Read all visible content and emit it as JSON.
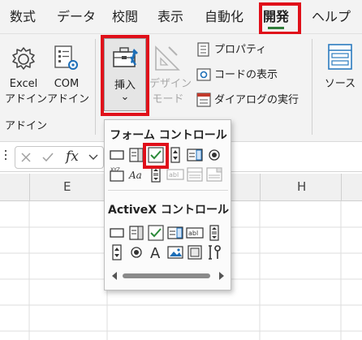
{
  "tabs": [
    "数式",
    "データ",
    "校閲",
    "表示",
    "自動化",
    "開発",
    "ヘルプ"
  ],
  "ribbon": {
    "excel_addin": [
      "Excel",
      "アドイン"
    ],
    "com_addin": [
      "COM",
      "アドイン"
    ],
    "group_addin": "アドイン",
    "insert": "挿入",
    "insert_arrow": "⌄",
    "design_mode": [
      "デザイン",
      "モード"
    ],
    "properties": "プロパティ",
    "view_code": "コードの表示",
    "run_dialog": "ダイアログの実行",
    "source": "ソース"
  },
  "formula_bar": {
    "fx": "fx"
  },
  "columns": [
    "E",
    "H"
  ],
  "dropdown": {
    "form_controls_title": "フォーム コントロール",
    "activex_title": "ActiveX コントロール",
    "xyz_label": "XYZ",
    "aa_label": "Aa",
    "abl_label": "abl",
    "big_a": "A"
  },
  "colors": {
    "highlight_red": "#e0101a",
    "active_tab_underline": "#2f7d3a",
    "check_green": "#2c8a3a"
  }
}
